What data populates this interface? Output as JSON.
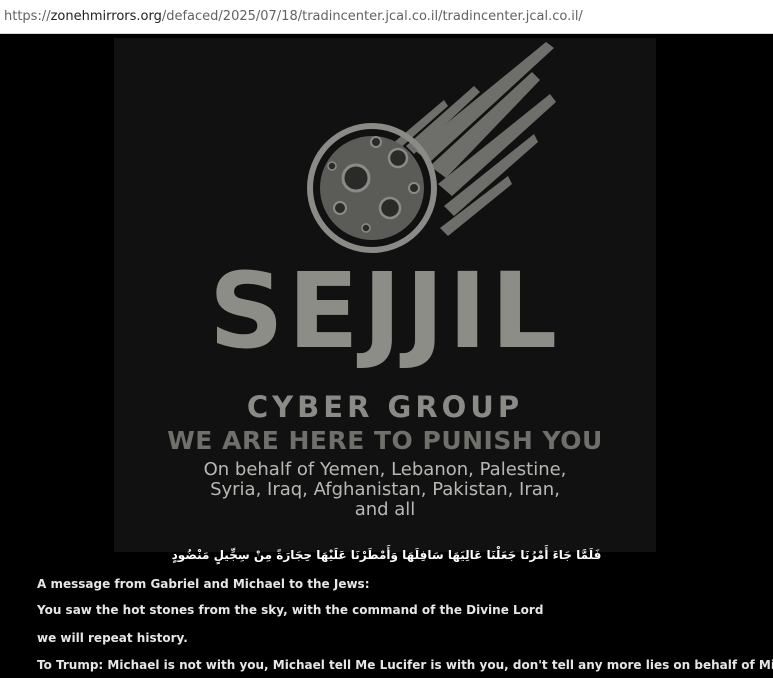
{
  "browser": {
    "url_scheme": "https://",
    "url_host": "zonehmirrors.org",
    "url_path": "/defaced/2025/07/18/tradincenter.jcal.co.il/tradincenter.jcal.co.il/"
  },
  "banner": {
    "logo_icon": "meteor-icon",
    "title": "SEJJIL",
    "subtitle": "CYBER GROUP",
    "slogan": "WE ARE HERE TO PUNISH YOU",
    "behalf_line1": "On behalf of Yemen, Lebanon, Palestine,",
    "behalf_line2": "Syria, Iraq, Afghanistan, Pakistan, Iran,",
    "behalf_line3": "and all"
  },
  "message": {
    "arabic_verse": "فَلَمَّا جَاءَ أَمْرُنَا جَعَلْنَا عَالِيَهَا سَافِلَهَا وَأَمْطَرْنَا عَلَيْهَا حِجَارَةً مِنْ سِجِّيلٍ مَنْضُودٍ",
    "line1": "A message from Gabriel and Michael to the Jews:",
    "line2": "You saw the hot stones from the sky, with the command of the Divine Lord",
    "line3": "we will repeat history.",
    "line4": "To Trump: Michael is not with you, Michael tell Me Lucifer is with you, don't tell any more lies on behalf of Michael"
  }
}
